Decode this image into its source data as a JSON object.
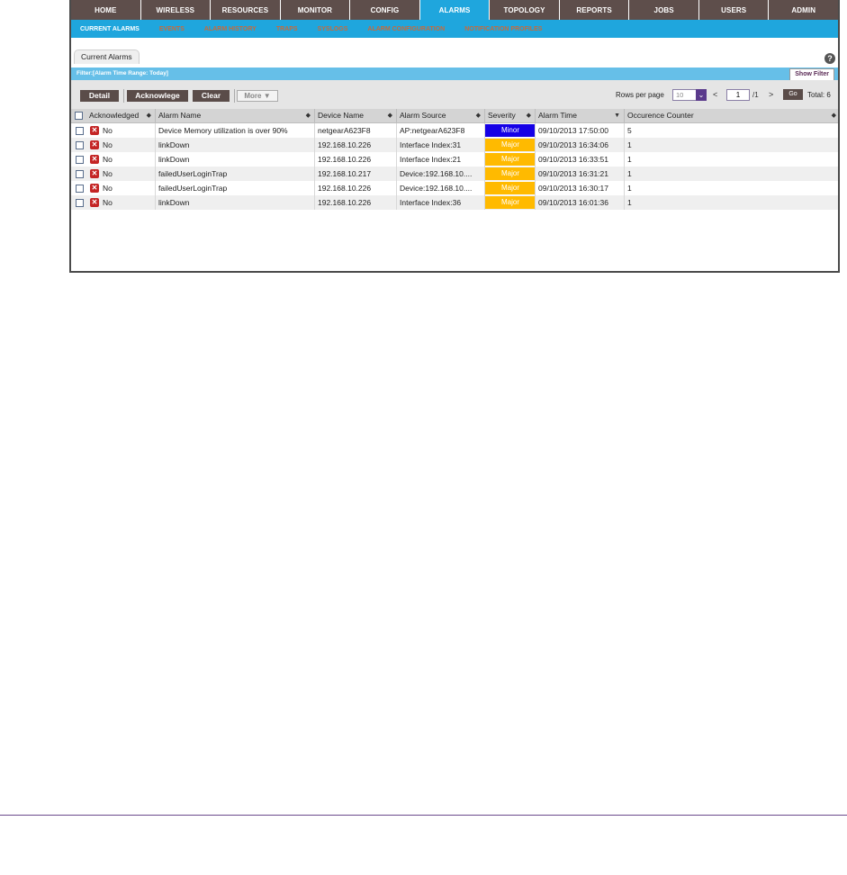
{
  "nav": {
    "items": [
      "HOME",
      "WIRELESS",
      "RESOURCES",
      "MONITOR",
      "CONFIG",
      "ALARMS",
      "TOPOLOGY",
      "REPORTS",
      "JOBS",
      "USERS",
      "ADMIN"
    ],
    "active": "ALARMS"
  },
  "subnav": {
    "items": [
      "CURRENT ALARMS",
      "EVENTS",
      "ALARM HISTORY",
      "TRAPS",
      "SYSLOGS",
      "ALARM CONFIGURATION",
      "NOTIFICATION PROFILES"
    ],
    "active": "CURRENT ALARMS"
  },
  "tab": {
    "label": "Current Alarms",
    "help": "?"
  },
  "filter": {
    "text": "Filter:[Alarm Time Range: Today]",
    "show_label": "Show Filter"
  },
  "toolbar": {
    "detail": "Detail",
    "acknowledge": "Acknowlege",
    "clear": "Clear",
    "more": "More ▼",
    "rows_per_page_label": "Rows per page",
    "rows_per_page_value": "10",
    "page_current": "1",
    "page_total": "/1",
    "go": "Go",
    "total": "Total: 6"
  },
  "table": {
    "columns": [
      "Acknowledged",
      "Alarm Name",
      "Device Name",
      "Alarm Source",
      "Severity",
      "Alarm Time",
      "Occurence Counter"
    ],
    "rows": [
      {
        "ack": "No",
        "name": "Device Memory utilization is over 90%",
        "device": "netgearA623F8",
        "source": "AP:netgearA623F8",
        "severity": "Minor",
        "time": "09/10/2013 17:50:00",
        "count": "5"
      },
      {
        "ack": "No",
        "name": "linkDown",
        "device": "192.168.10.226",
        "source": "Interface Index:31",
        "severity": "Major",
        "time": "09/10/2013 16:34:06",
        "count": "1"
      },
      {
        "ack": "No",
        "name": "linkDown",
        "device": "192.168.10.226",
        "source": "Interface Index:21",
        "severity": "Major",
        "time": "09/10/2013 16:33:51",
        "count": "1"
      },
      {
        "ack": "No",
        "name": "failedUserLoginTrap",
        "device": "192.168.10.217",
        "source": "Device:192.168.10....",
        "severity": "Major",
        "time": "09/10/2013 16:31:21",
        "count": "1"
      },
      {
        "ack": "No",
        "name": "failedUserLoginTrap",
        "device": "192.168.10.226",
        "source": "Device:192.168.10....",
        "severity": "Major",
        "time": "09/10/2013 16:30:17",
        "count": "1"
      },
      {
        "ack": "No",
        "name": "linkDown",
        "device": "192.168.10.226",
        "source": "Interface Index:36",
        "severity": "Major",
        "time": "09/10/2013 16:01:36",
        "count": "1"
      }
    ]
  },
  "colors": {
    "nav_bg": "#5e4e4b",
    "accent": "#1fa6dd",
    "minor": "#1500e6",
    "major": "#ffba00",
    "ack_no": "#c42525"
  }
}
